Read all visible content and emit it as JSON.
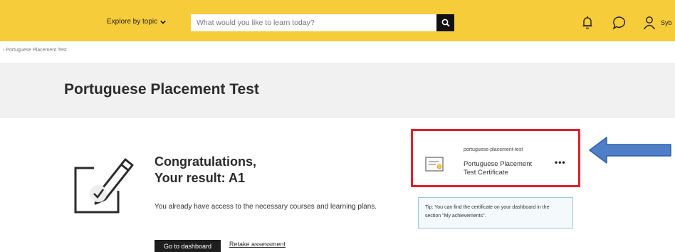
{
  "topbar": {
    "explore_label": "Explore by topic",
    "search_placeholder": "What would you like to learn today?",
    "user_name": "Syb"
  },
  "breadcrumb": {
    "text": "›  Portuguese Placement Test"
  },
  "hero": {
    "title": "Portuguese Placement Test"
  },
  "result": {
    "heading_line1": "Congratulations,",
    "heading_line2": "Your result: A1",
    "description": "You already have access to the necessary courses and learning plans.",
    "dashboard_button": "Go to dashboard",
    "retake_link": "Retake assessment"
  },
  "certificate": {
    "slug": "portuguese-placement-test",
    "name": "Portuguese Placement Test Certificate",
    "more": "•••"
  },
  "tip": {
    "text": "Tip: You can find the certificate on your dashboard in the section \"My achievements\"."
  },
  "colors": {
    "brand_yellow": "#f6cc3a",
    "highlight_red": "#e0202a",
    "annotation_arrow": "#4f7fc6"
  },
  "icons": {
    "explore": "chevron-down-icon",
    "search": "search-icon",
    "notifications": "bell-icon",
    "messages": "chat-bubble-icon",
    "account": "user-icon",
    "illustration": "document-pencil-check-icon",
    "certificate": "certificate-document-icon"
  }
}
